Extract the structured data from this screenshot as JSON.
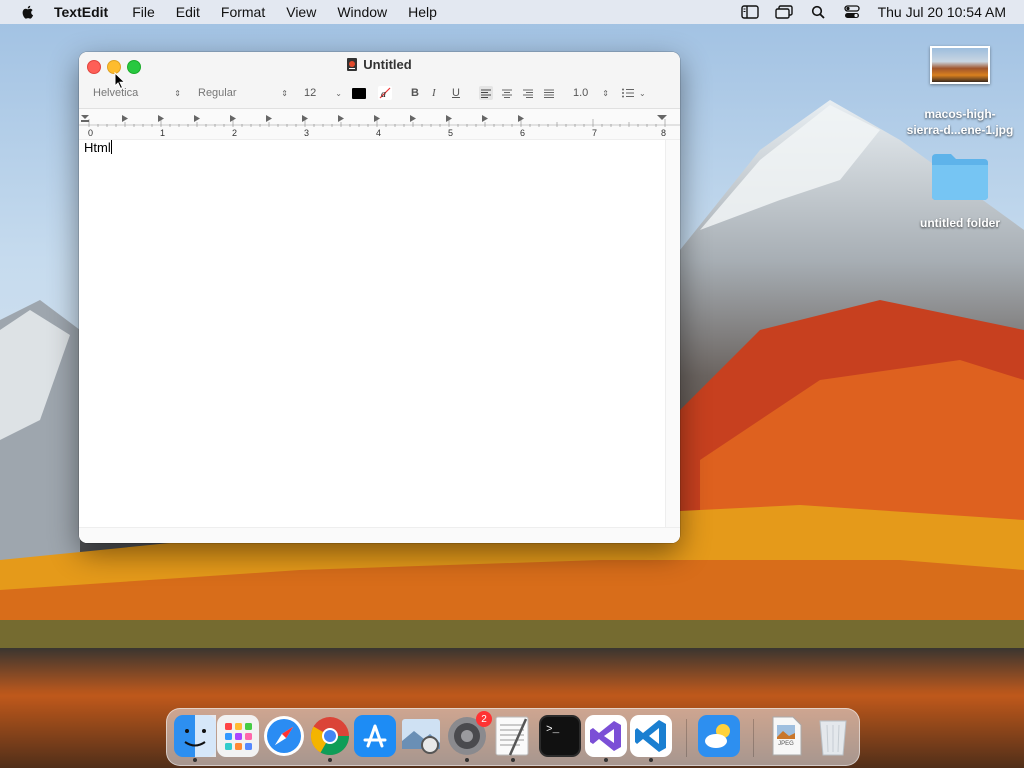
{
  "menubar": {
    "app_name": "TextEdit",
    "menus": [
      "File",
      "Edit",
      "Format",
      "View",
      "Window",
      "Help"
    ],
    "clock": "Thu Jul 20  10:54 AM"
  },
  "desktop": {
    "items": [
      {
        "label_line1": "macos-high-",
        "label_line2": "sierra-d...ene-1.jpg",
        "icon": "image-thumbnail-icon"
      },
      {
        "label_line1": "untitled folder",
        "label_line2": "",
        "icon": "folder-icon"
      }
    ]
  },
  "window": {
    "title": "Untitled",
    "toolbar": {
      "font_family": "Helvetica",
      "font_style": "Regular",
      "font_size": "12",
      "bold": "B",
      "italic": "I",
      "underline": "U",
      "line_spacing": "1.0"
    },
    "ruler": {
      "marks": [
        "0",
        "1",
        "2",
        "3",
        "4",
        "5",
        "6",
        "7",
        "8"
      ]
    },
    "document_text": "Html"
  },
  "dock": {
    "apps": [
      {
        "name": "Finder",
        "icon": "finder-icon",
        "running": true
      },
      {
        "name": "Launchpad",
        "icon": "launchpad-icon",
        "running": false
      },
      {
        "name": "Safari",
        "icon": "safari-icon",
        "running": false
      },
      {
        "name": "Chrome",
        "icon": "chrome-icon",
        "running": true
      },
      {
        "name": "App Store",
        "icon": "app-store-icon",
        "running": false
      },
      {
        "name": "Preview",
        "icon": "preview-icon",
        "running": false
      },
      {
        "name": "System Preferences",
        "icon": "settings-icon",
        "running": true,
        "badge": "2"
      },
      {
        "name": "TextEdit",
        "icon": "textedit-icon",
        "running": true
      },
      {
        "name": "Terminal",
        "icon": "terminal-icon",
        "running": false
      },
      {
        "name": "Visual Studio",
        "icon": "visual-studio-icon",
        "running": true
      },
      {
        "name": "VS Code",
        "icon": "vscode-icon",
        "running": true
      },
      {
        "name": "Weather",
        "icon": "weather-icon",
        "running": false
      },
      {
        "name": "JPEG Document",
        "icon": "jpeg-document-icon",
        "running": false
      },
      {
        "name": "Trash",
        "icon": "trash-icon",
        "running": false
      }
    ],
    "jpeg_label": "JPEG"
  },
  "colors": {
    "accent_blue": "#1f7ae0",
    "close": "#fe5f57",
    "minimize": "#febc2e",
    "maximize": "#28c840"
  }
}
